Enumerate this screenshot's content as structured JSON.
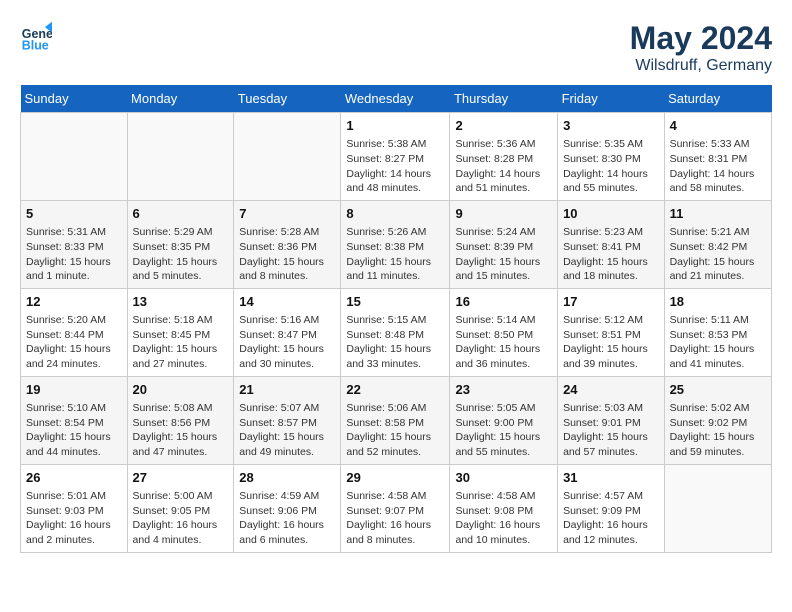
{
  "header": {
    "logo_line1": "General",
    "logo_line2": "Blue",
    "month": "May 2024",
    "location": "Wilsdruff, Germany"
  },
  "days_of_week": [
    "Sunday",
    "Monday",
    "Tuesday",
    "Wednesday",
    "Thursday",
    "Friday",
    "Saturday"
  ],
  "weeks": [
    [
      {
        "day": "",
        "info": ""
      },
      {
        "day": "",
        "info": ""
      },
      {
        "day": "",
        "info": ""
      },
      {
        "day": "1",
        "info": "Sunrise: 5:38 AM\nSunset: 8:27 PM\nDaylight: 14 hours\nand 48 minutes."
      },
      {
        "day": "2",
        "info": "Sunrise: 5:36 AM\nSunset: 8:28 PM\nDaylight: 14 hours\nand 51 minutes."
      },
      {
        "day": "3",
        "info": "Sunrise: 5:35 AM\nSunset: 8:30 PM\nDaylight: 14 hours\nand 55 minutes."
      },
      {
        "day": "4",
        "info": "Sunrise: 5:33 AM\nSunset: 8:31 PM\nDaylight: 14 hours\nand 58 minutes."
      }
    ],
    [
      {
        "day": "5",
        "info": "Sunrise: 5:31 AM\nSunset: 8:33 PM\nDaylight: 15 hours\nand 1 minute."
      },
      {
        "day": "6",
        "info": "Sunrise: 5:29 AM\nSunset: 8:35 PM\nDaylight: 15 hours\nand 5 minutes."
      },
      {
        "day": "7",
        "info": "Sunrise: 5:28 AM\nSunset: 8:36 PM\nDaylight: 15 hours\nand 8 minutes."
      },
      {
        "day": "8",
        "info": "Sunrise: 5:26 AM\nSunset: 8:38 PM\nDaylight: 15 hours\nand 11 minutes."
      },
      {
        "day": "9",
        "info": "Sunrise: 5:24 AM\nSunset: 8:39 PM\nDaylight: 15 hours\nand 15 minutes."
      },
      {
        "day": "10",
        "info": "Sunrise: 5:23 AM\nSunset: 8:41 PM\nDaylight: 15 hours\nand 18 minutes."
      },
      {
        "day": "11",
        "info": "Sunrise: 5:21 AM\nSunset: 8:42 PM\nDaylight: 15 hours\nand 21 minutes."
      }
    ],
    [
      {
        "day": "12",
        "info": "Sunrise: 5:20 AM\nSunset: 8:44 PM\nDaylight: 15 hours\nand 24 minutes."
      },
      {
        "day": "13",
        "info": "Sunrise: 5:18 AM\nSunset: 8:45 PM\nDaylight: 15 hours\nand 27 minutes."
      },
      {
        "day": "14",
        "info": "Sunrise: 5:16 AM\nSunset: 8:47 PM\nDaylight: 15 hours\nand 30 minutes."
      },
      {
        "day": "15",
        "info": "Sunrise: 5:15 AM\nSunset: 8:48 PM\nDaylight: 15 hours\nand 33 minutes."
      },
      {
        "day": "16",
        "info": "Sunrise: 5:14 AM\nSunset: 8:50 PM\nDaylight: 15 hours\nand 36 minutes."
      },
      {
        "day": "17",
        "info": "Sunrise: 5:12 AM\nSunset: 8:51 PM\nDaylight: 15 hours\nand 39 minutes."
      },
      {
        "day": "18",
        "info": "Sunrise: 5:11 AM\nSunset: 8:53 PM\nDaylight: 15 hours\nand 41 minutes."
      }
    ],
    [
      {
        "day": "19",
        "info": "Sunrise: 5:10 AM\nSunset: 8:54 PM\nDaylight: 15 hours\nand 44 minutes."
      },
      {
        "day": "20",
        "info": "Sunrise: 5:08 AM\nSunset: 8:56 PM\nDaylight: 15 hours\nand 47 minutes."
      },
      {
        "day": "21",
        "info": "Sunrise: 5:07 AM\nSunset: 8:57 PM\nDaylight: 15 hours\nand 49 minutes."
      },
      {
        "day": "22",
        "info": "Sunrise: 5:06 AM\nSunset: 8:58 PM\nDaylight: 15 hours\nand 52 minutes."
      },
      {
        "day": "23",
        "info": "Sunrise: 5:05 AM\nSunset: 9:00 PM\nDaylight: 15 hours\nand 55 minutes."
      },
      {
        "day": "24",
        "info": "Sunrise: 5:03 AM\nSunset: 9:01 PM\nDaylight: 15 hours\nand 57 minutes."
      },
      {
        "day": "25",
        "info": "Sunrise: 5:02 AM\nSunset: 9:02 PM\nDaylight: 15 hours\nand 59 minutes."
      }
    ],
    [
      {
        "day": "26",
        "info": "Sunrise: 5:01 AM\nSunset: 9:03 PM\nDaylight: 16 hours\nand 2 minutes."
      },
      {
        "day": "27",
        "info": "Sunrise: 5:00 AM\nSunset: 9:05 PM\nDaylight: 16 hours\nand 4 minutes."
      },
      {
        "day": "28",
        "info": "Sunrise: 4:59 AM\nSunset: 9:06 PM\nDaylight: 16 hours\nand 6 minutes."
      },
      {
        "day": "29",
        "info": "Sunrise: 4:58 AM\nSunset: 9:07 PM\nDaylight: 16 hours\nand 8 minutes."
      },
      {
        "day": "30",
        "info": "Sunrise: 4:58 AM\nSunset: 9:08 PM\nDaylight: 16 hours\nand 10 minutes."
      },
      {
        "day": "31",
        "info": "Sunrise: 4:57 AM\nSunset: 9:09 PM\nDaylight: 16 hours\nand 12 minutes."
      },
      {
        "day": "",
        "info": ""
      }
    ]
  ]
}
